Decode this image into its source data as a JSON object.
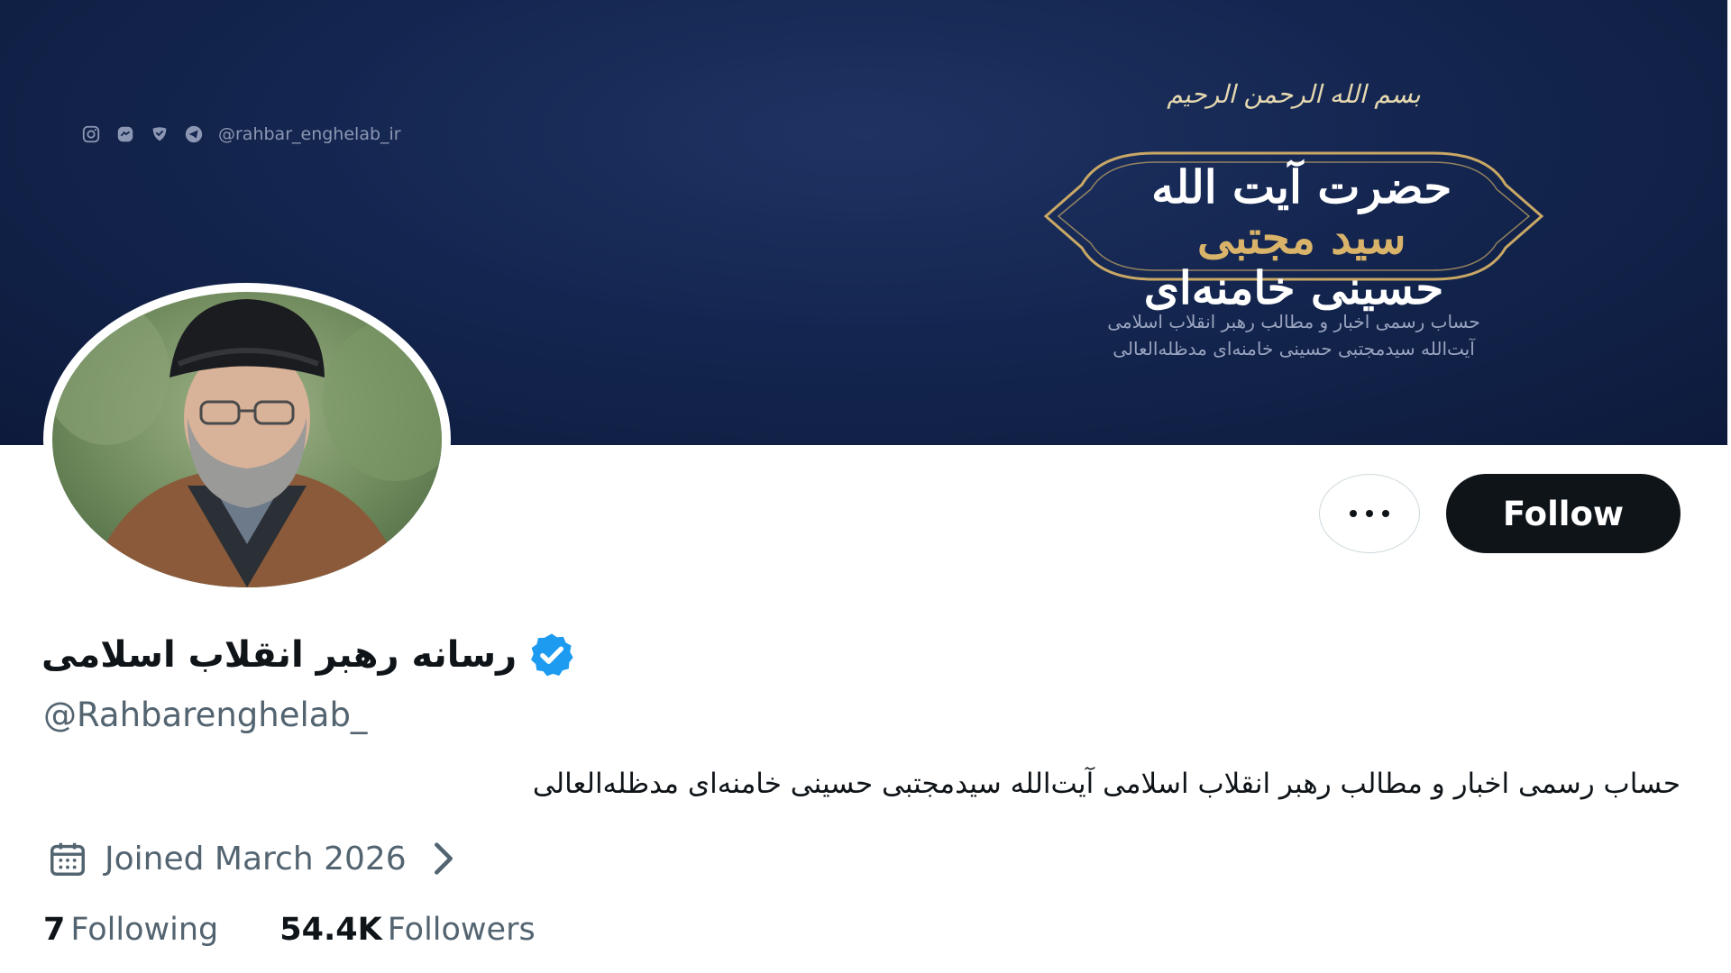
{
  "banner": {
    "social_handle": "@rahbar_enghelab_ir",
    "social_icons": [
      "instagram-icon",
      "messenger-icon",
      "shield-icon",
      "telegram-icon"
    ],
    "bismillah": "بسم الله الرحمن الرحیم",
    "title_line1": "حضرت آیت الله",
    "title_gold": "سید مجتبی",
    "title_line2": "حسینی خامنه‌ای",
    "subtitle_line1": "حساب رسمی اخبار و مطالب رهبر انقلاب اسلامی",
    "subtitle_line2": "آیت‌الله سیدمجتبی حسینی خامنه‌ای مدظله‌العالی",
    "bg_color": "#142650",
    "gold_color": "#d9b36a"
  },
  "profile": {
    "display_name": "رسانه رهبر انقلاب اسلامی",
    "verified_icon": "verified-badge-icon",
    "handle": "@Rahbarenghelab_",
    "bio": "حساب رسمی اخبار و مطالب رهبر انقلاب اسلامی آیت‌الله سیدمجتبی حسینی خامنه‌ای مدظله‌العالی",
    "joined": "Joined March 2026",
    "following_count": "7",
    "following_label": "Following",
    "followers_count": "54.4K",
    "followers_label": "Followers"
  },
  "actions": {
    "follow_label": "Follow",
    "more_icon": "more-options-icon"
  },
  "colors": {
    "follow_bg": "#0f1419",
    "verified_blue": "#1d9bf0",
    "muted_text": "#536471"
  }
}
